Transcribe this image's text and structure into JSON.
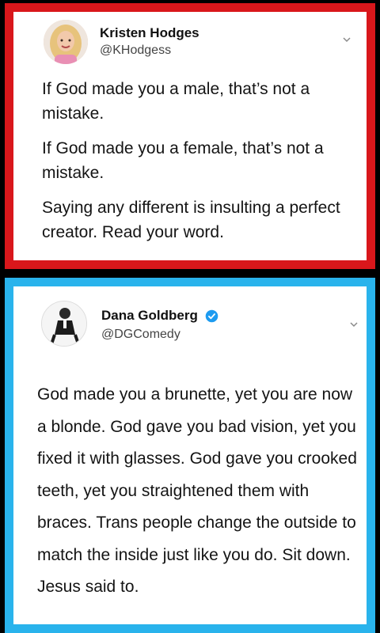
{
  "tweet_top": {
    "author_name": "Kristen Hodges",
    "author_handle": "@KHodgess",
    "paragraphs": [
      "If God made you a male, that’s not a mistake.",
      "If God made you a female, that’s not a mistake.",
      "Saying any different is insulting a perfect creator. Read your word."
    ],
    "frame_color": "#d9171b"
  },
  "tweet_bottom": {
    "author_name": "Dana Goldberg",
    "author_handle": "@DGComedy",
    "verified": true,
    "text": "God made you a brunette, yet you are now a blonde. God gave you bad vision, yet you fixed it with glasses. God gave you crooked teeth, yet you straightened them with braces. Trans people change the outside to match the inside just like you do. Sit down. Jesus said to.",
    "frame_color": "#29b3ec"
  },
  "icons": {
    "menu": "chevron-down-icon",
    "verified": "verified-badge-icon"
  }
}
